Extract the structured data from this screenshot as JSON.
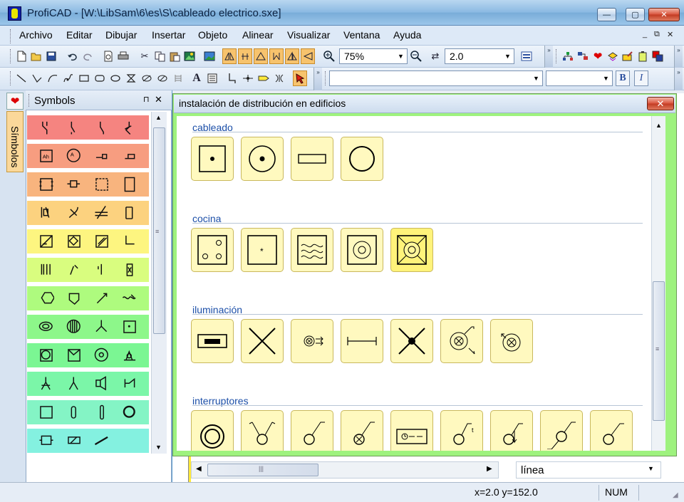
{
  "window": {
    "title": "ProfiCAD - [W:\\LibSam\\6\\es\\S\\cableado electrico.sxe]",
    "minimize_glyph": "—",
    "maximize_glyph": "▢",
    "close_glyph": "✕"
  },
  "menu": {
    "items": [
      "Archivo",
      "Editar",
      "Dibujar",
      "Insertar",
      "Objeto",
      "Alinear",
      "Visualizar",
      "Ventana",
      "Ayuda"
    ],
    "mdi_minimize": "_",
    "mdi_restore": "⧉",
    "mdi_close": "✕"
  },
  "toolbar": {
    "zoom_value": "75%",
    "line_width_value": "2.0",
    "font_value": "",
    "size_value": "",
    "bold_label": "B",
    "italic_label": "I"
  },
  "left_panel": {
    "fav_tab_icon": "heart-icon",
    "fav_tab_glyph": "❤",
    "vertical_tab_label": "Símbolos",
    "title": "Symbols",
    "pin_glyph": "📌",
    "close_glyph": "✕",
    "row_colors": [
      "#f58480",
      "#f79d80",
      "#f8b47e",
      "#fcd27f",
      "#fdf580",
      "#d9fd7f",
      "#aefb7e",
      "#8df78a",
      "#7bf693",
      "#7bf6a8",
      "#84f4c5",
      "#84f1e0"
    ]
  },
  "document": {
    "title": "instalación de distribución en edificios",
    "close_glyph": "✕",
    "sections": [
      {
        "title": "cableado"
      },
      {
        "title": "cocina"
      },
      {
        "title": "iluminación"
      },
      {
        "title": "interruptores"
      }
    ]
  },
  "bottom": {
    "property_value": "línea",
    "coords": "x=2.0  y=152.0",
    "num": "NUM"
  }
}
